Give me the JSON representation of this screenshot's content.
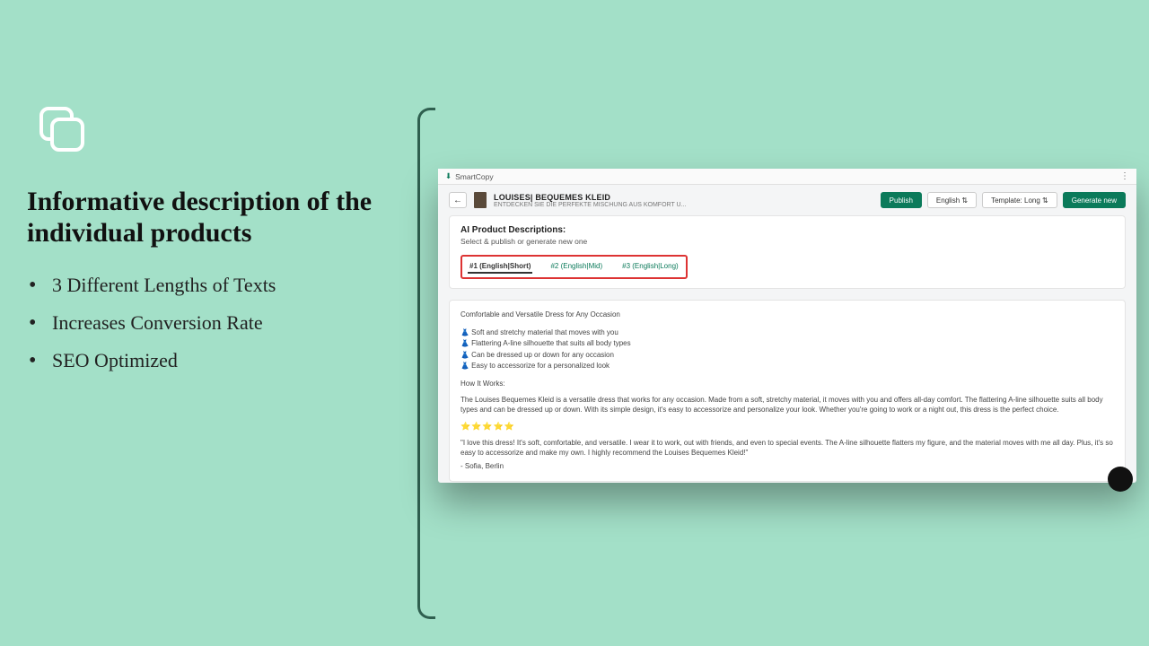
{
  "left": {
    "headline": "Informative description of the individual products",
    "bullets": [
      "3 Different Lengths of Texts",
      "Increases Conversion Rate",
      "SEO Optimized"
    ]
  },
  "app": {
    "brand": "SmartCopy",
    "product": {
      "name": "LOUISES| BEQUEMES KLEID",
      "subtitle": "ENTDECKEN SIE DIE PERFEKTE MISCHUNG AUS KOMFORT U..."
    },
    "actions": {
      "publish": "Publish",
      "language": "English  ⇅",
      "template": "Template:  Long  ⇅",
      "generate": "Generate new"
    },
    "card": {
      "title": "AI Product Descriptions:",
      "subtitle": "Select & publish or generate new one",
      "tabs": [
        "#1 (English|Short)",
        "#2 (English|Mid)",
        "#3 (English|Long)"
      ]
    },
    "description": {
      "lead": "Comfortable and Versatile Dress for Any Occasion",
      "features": [
        "👗 Soft and stretchy material that moves with you",
        "👗 Flattering A-line silhouette that suits all body types",
        "👗 Can be dressed up or down for any occasion",
        "👗 Easy to accessorize for a personalized look"
      ],
      "how_heading": "How It Works:",
      "how_body": "The Louises Bequemes Kleid is a versatile dress that works for any occasion. Made from a soft, stretchy material, it moves with you and offers all-day comfort. The flattering A-line silhouette suits all body types and can be dressed up or down. With its simple design, it's easy to accessorize and personalize your look. Whether you're going to work or a night out, this dress is the perfect choice.",
      "stars": "⭐⭐⭐⭐⭐",
      "quote": "\"I love this dress! It's soft, comfortable, and versatile. I wear it to work, out with friends, and even to special events. The A-line silhouette flatters my figure, and the material moves with me all day. Plus, it's so easy to accessorize and make my own. I highly recommend the Louises Bequemes Kleid!\"",
      "signature": "- Sofia, Berlin"
    }
  }
}
